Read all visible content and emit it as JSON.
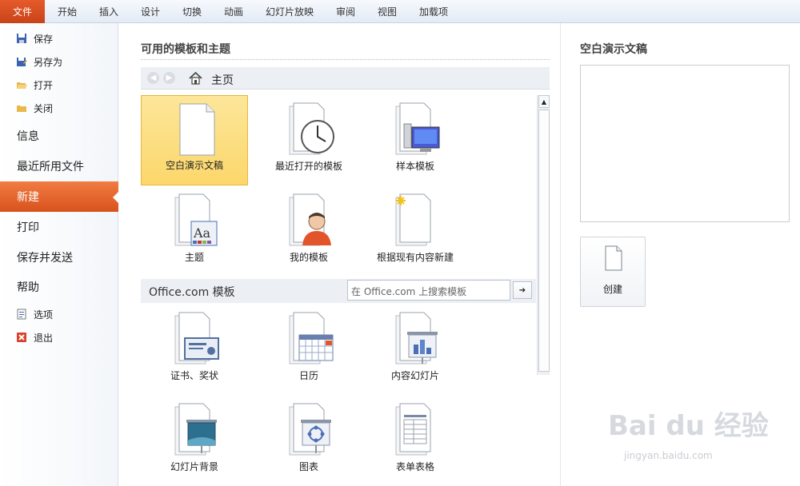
{
  "ribbon": {
    "file_tab": "文件",
    "tabs": [
      "开始",
      "插入",
      "设计",
      "切换",
      "动画",
      "幻灯片放映",
      "审阅",
      "视图",
      "加载项"
    ]
  },
  "leftnav": {
    "save": "保存",
    "save_as": "另存为",
    "open": "打开",
    "close": "关闭",
    "info": "信息",
    "recent": "最近所用文件",
    "new": "新建",
    "print": "打印",
    "save_send": "保存并发送",
    "help": "帮助",
    "options": "选项",
    "exit": "退出"
  },
  "middle": {
    "title": "可用的模板和主题",
    "home": "主页",
    "tiles_top": [
      "空白演示文稿",
      "最近打开的模板",
      "样本模板",
      "主题",
      "我的模板",
      "根据现有内容新建"
    ],
    "office_title": "Office.com 模板",
    "search_placeholder": "在 Office.com 上搜索模板",
    "tiles_office": [
      "证书、奖状",
      "日历",
      "内容幻灯片",
      "幻灯片背景",
      "图表",
      "表单表格"
    ]
  },
  "right": {
    "title": "空白演示文稿",
    "create": "创建"
  },
  "watermark": {
    "logo": "Bai du 经验",
    "url": "jingyan.baidu.com"
  },
  "colors": {
    "accent": "#d8521c",
    "selected_tile": "#fcd76b"
  }
}
